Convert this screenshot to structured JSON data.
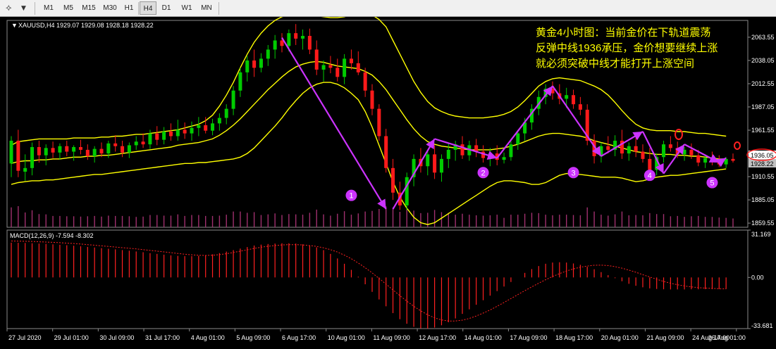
{
  "toolbar": {
    "drawing_tools_icon": "drawing-tools-icon",
    "timeframes": [
      {
        "label": "M1",
        "active": false
      },
      {
        "label": "M5",
        "active": false
      },
      {
        "label": "M15",
        "active": false
      },
      {
        "label": "M30",
        "active": false
      },
      {
        "label": "H1",
        "active": false
      },
      {
        "label": "H4",
        "active": true
      },
      {
        "label": "D1",
        "active": false
      },
      {
        "label": "W1",
        "active": false
      },
      {
        "label": "MN",
        "active": false
      }
    ]
  },
  "chart_data": [
    {
      "type": "candlestick",
      "header": "XAUUSD,H4  1929.07 1929.08 1928.18 1928.22",
      "ohlc_series": [
        [
          1925,
          1955,
          1910,
          1950
        ],
        [
          1950,
          1962,
          1910,
          1917
        ],
        [
          1916,
          1935,
          1906,
          1920
        ],
        [
          1920,
          1948,
          1912,
          1943
        ],
        [
          1943,
          1950,
          1926,
          1934
        ],
        [
          1934,
          1946,
          1923,
          1942
        ],
        [
          1942,
          1949,
          1931,
          1937
        ],
        [
          1937,
          1947,
          1929,
          1944
        ],
        [
          1944,
          1950,
          1933,
          1938
        ],
        [
          1938,
          1945,
          1928,
          1943
        ],
        [
          1943,
          1951,
          1935,
          1940
        ],
        [
          1940,
          1946,
          1929,
          1933
        ],
        [
          1933,
          1944,
          1926,
          1941
        ],
        [
          1941,
          1948,
          1932,
          1936
        ],
        [
          1936,
          1950,
          1931,
          1947
        ],
        [
          1947,
          1956,
          1938,
          1944
        ],
        [
          1944,
          1950,
          1932,
          1937
        ],
        [
          1937,
          1948,
          1931,
          1945
        ],
        [
          1945,
          1955,
          1940,
          1949
        ],
        [
          1949,
          1958,
          1942,
          1946
        ],
        [
          1946,
          1962,
          1941,
          1958
        ],
        [
          1958,
          1966,
          1945,
          1951
        ],
        [
          1951,
          1965,
          1946,
          1960
        ],
        [
          1960,
          1969,
          1950,
          1955
        ],
        [
          1955,
          1973,
          1950,
          1962
        ],
        [
          1962,
          1970,
          1952,
          1958
        ],
        [
          1958,
          1971,
          1950,
          1964
        ],
        [
          1964,
          1976,
          1955,
          1967
        ],
        [
          1967,
          1976,
          1958,
          1961
        ],
        [
          1961,
          1974,
          1956,
          1969
        ],
        [
          1969,
          1980,
          1961,
          1975
        ],
        [
          1975,
          1990,
          1968,
          1985
        ],
        [
          1985,
          2010,
          1978,
          2005
        ],
        [
          2005,
          2030,
          1998,
          2025
        ],
        [
          2025,
          2043,
          2015,
          2038
        ],
        [
          2038,
          2050,
          2020,
          2030
        ],
        [
          2030,
          2046,
          2025,
          2040
        ],
        [
          2040,
          2055,
          2032,
          2050
        ],
        [
          2050,
          2066,
          2040,
          2060
        ],
        [
          2060,
          2068,
          2047,
          2054
        ],
        [
          2054,
          2072,
          2048,
          2068
        ],
        [
          2068,
          2078,
          2055,
          2062
        ],
        [
          2062,
          2072,
          2050,
          2065
        ],
        [
          2065,
          2073,
          2045,
          2050
        ],
        [
          2050,
          2060,
          2022,
          2028
        ],
        [
          2028,
          2038,
          2015,
          2033
        ],
        [
          2033,
          2043,
          2024,
          2030
        ],
        [
          2030,
          2040,
          2015,
          2020
        ],
        [
          2020,
          2045,
          2012,
          2040
        ],
        [
          2040,
          2050,
          2028,
          2035
        ],
        [
          2035,
          2048,
          2022,
          2025
        ],
        [
          2025,
          2030,
          1998,
          2005
        ],
        [
          2005,
          2012,
          1978,
          1985
        ],
        [
          1985,
          1990,
          1950,
          1955
        ],
        [
          1955,
          1963,
          1915,
          1920
        ],
        [
          1920,
          1930,
          1885,
          1893
        ],
        [
          1893,
          1905,
          1874,
          1879
        ],
        [
          1879,
          1915,
          1874,
          1910
        ],
        [
          1910,
          1935,
          1900,
          1930
        ],
        [
          1930,
          1942,
          1915,
          1922
        ],
        [
          1922,
          1940,
          1912,
          1935
        ],
        [
          1935,
          1945,
          1908,
          1915
        ],
        [
          1915,
          1935,
          1905,
          1930
        ],
        [
          1930,
          1948,
          1920,
          1940
        ],
        [
          1940,
          1950,
          1928,
          1946
        ],
        [
          1946,
          1955,
          1930,
          1934
        ],
        [
          1934,
          1950,
          1928,
          1945
        ],
        [
          1945,
          1952,
          1932,
          1938
        ],
        [
          1938,
          1945,
          1926,
          1931
        ],
        [
          1931,
          1942,
          1922,
          1936
        ],
        [
          1936,
          1945,
          1923,
          1929
        ],
        [
          1929,
          1937,
          1925,
          1932
        ],
        [
          1932,
          1950,
          1928,
          1946
        ],
        [
          1946,
          1962,
          1940,
          1958
        ],
        [
          1958,
          1975,
          1950,
          1970
        ],
        [
          1970,
          1990,
          1962,
          1985
        ],
        [
          1985,
          2005,
          1978,
          1998
        ],
        [
          1998,
          2012,
          1990,
          2007
        ],
        [
          2007,
          2015,
          1995,
          2002
        ],
        [
          2002,
          2012,
          1990,
          1996
        ],
        [
          1996,
          2008,
          1986,
          2000
        ],
        [
          2000,
          2006,
          1985,
          1990
        ],
        [
          1990,
          1998,
          1978,
          1984
        ],
        [
          1984,
          1990,
          1945,
          1950
        ],
        [
          1950,
          1957,
          1925,
          1933
        ],
        [
          1933,
          1948,
          1926,
          1944
        ],
        [
          1944,
          1955,
          1936,
          1940
        ],
        [
          1940,
          1956,
          1933,
          1950
        ],
        [
          1950,
          1962,
          1930,
          1936
        ],
        [
          1936,
          1948,
          1928,
          1944
        ],
        [
          1944,
          1953,
          1932,
          1938
        ],
        [
          1938,
          1946,
          1926,
          1930
        ],
        [
          1930,
          1942,
          1915,
          1918
        ],
        [
          1918,
          1936,
          1912,
          1932
        ],
        [
          1932,
          1950,
          1926,
          1946
        ],
        [
          1946,
          1955,
          1938,
          1942
        ],
        [
          1942,
          1949,
          1931,
          1935
        ],
        [
          1935,
          1943,
          1928,
          1940
        ],
        [
          1940,
          1947,
          1930,
          1934
        ],
        [
          1934,
          1940,
          1922,
          1926
        ],
        [
          1926,
          1935,
          1920,
          1931
        ],
        [
          1931,
          1938,
          1923,
          1929
        ],
        [
          1929,
          1934,
          1921,
          1924
        ],
        [
          1924,
          1932,
          1920,
          1930
        ],
        [
          1930,
          1936,
          1926,
          1928
        ]
      ],
      "bollinger": {
        "upper": [
          1945,
          1949,
          1950,
          1951,
          1952,
          1952,
          1952,
          1952,
          1952,
          1953,
          1953,
          1953,
          1953,
          1954,
          1954,
          1955,
          1955,
          1956,
          1957,
          1957,
          1958,
          1959,
          1960,
          1961,
          1962,
          1964,
          1966,
          1968,
          1972,
          1978,
          1988,
          2000,
          2014,
          2030,
          2045,
          2058,
          2068,
          2076,
          2082,
          2086,
          2088,
          2089,
          2089,
          2088,
          2087,
          2086,
          2085,
          2085,
          2086,
          2088,
          2090,
          2090,
          2088,
          2083,
          2075,
          2060,
          2045,
          2030,
          2015,
          2003,
          1993,
          1986,
          1982,
          1979,
          1977,
          1976,
          1975,
          1975,
          1975,
          1976,
          1977,
          1979,
          1982,
          1987,
          1994,
          2002,
          2010,
          2015,
          2018,
          2019,
          2018,
          2017,
          2016,
          2013,
          2010,
          2006,
          2000,
          1992,
          1983,
          1975,
          1968,
          1964,
          1962,
          1961,
          1961,
          1961,
          1960,
          1960,
          1959,
          1958,
          1958,
          1957,
          1956,
          1955
        ],
        "middle": [
          1925,
          1927,
          1928,
          1928,
          1929,
          1929,
          1930,
          1930,
          1931,
          1932,
          1932,
          1933,
          1933,
          1934,
          1934,
          1935,
          1936,
          1937,
          1938,
          1939,
          1940,
          1941,
          1942,
          1943,
          1945,
          1946,
          1947,
          1948,
          1950,
          1952,
          1956,
          1961,
          1967,
          1974,
          1982,
          1990,
          1998,
          2006,
          2013,
          2020,
          2026,
          2031,
          2034,
          2036,
          2037,
          2036,
          2034,
          2032,
          2031,
          2030,
          2029,
          2026,
          2022,
          2015,
          2006,
          1995,
          1984,
          1973,
          1963,
          1955,
          1949,
          1946,
          1944,
          1943,
          1942,
          1941,
          1940,
          1940,
          1940,
          1940,
          1941,
          1942,
          1944,
          1946,
          1949,
          1952,
          1955,
          1957,
          1958,
          1958,
          1957,
          1956,
          1955,
          1953,
          1950,
          1948,
          1946,
          1944,
          1942,
          1940,
          1938,
          1937,
          1936,
          1935,
          1935,
          1935,
          1934,
          1934,
          1933,
          1933,
          1932,
          1931,
          1930,
          1930
        ],
        "lower": [
          1902,
          1904,
          1905,
          1906,
          1906,
          1907,
          1907,
          1908,
          1909,
          1910,
          1911,
          1912,
          1913,
          1913,
          1914,
          1915,
          1916,
          1917,
          1918,
          1919,
          1920,
          1921,
          1922,
          1923,
          1924,
          1925,
          1925,
          1926,
          1926,
          1927,
          1928,
          1929,
          1930,
          1932,
          1936,
          1942,
          1950,
          1958,
          1966,
          1975,
          1985,
          1994,
          2002,
          2008,
          2012,
          2014,
          2014,
          2012,
          2008,
          2002,
          1995,
          1982,
          1965,
          1945,
          1925,
          1905,
          1888,
          1876,
          1866,
          1860,
          1858,
          1860,
          1865,
          1870,
          1875,
          1880,
          1885,
          1890,
          1895,
          1900,
          1904,
          1906,
          1906,
          1905,
          1904,
          1902,
          1902,
          1904,
          1908,
          1912,
          1914,
          1913,
          1913,
          1912,
          1911,
          1910,
          1910,
          1910,
          1909,
          1907,
          1905,
          1906,
          1908,
          1910,
          1911,
          1912,
          1912,
          1913,
          1914,
          1915,
          1916,
          1917,
          1918,
          1919
        ]
      },
      "y_ticks": [
        "2063.55",
        "2038.05",
        "2012.55",
        "1987.05",
        "1961.55",
        "1936.05",
        "1910.55",
        "1885.05",
        "1859.55"
      ],
      "y_range": [
        1855,
        2082
      ],
      "current_price_labels": [
        "1936.05",
        "1928.22"
      ],
      "annotation_lines": [
        "黄金4小时图：当前金价在下轨道震荡",
        "反弹中线1936承压，金价想要继续上涨",
        "就必须突破中线才能打开上涨空间"
      ],
      "markers": [
        "1",
        "2",
        "3",
        "4",
        "5"
      ],
      "colors": {
        "bull": "#00cc00",
        "bear": "#ff1a1a",
        "bands": "#ffff00",
        "arrows": "#cc33ff",
        "volume": "#a0306e",
        "annotation": "#ffff00",
        "highlight": "#ff2020"
      }
    },
    {
      "type": "bar",
      "header": "MACD(12,26,9) -7.594 -8.302",
      "y_ticks": [
        "31.169",
        "0.00",
        "-33.681"
      ],
      "y_range": [
        -33.681,
        31.169
      ],
      "histogram": [
        22.9,
        22.8,
        22.7,
        22.5,
        22.3,
        22.1,
        21.8,
        21.5,
        21.2,
        20.9,
        20.5,
        20.1,
        19.7,
        19.3,
        18.9,
        18.5,
        18.0,
        17.6,
        17.1,
        16.6,
        16.0,
        15.5,
        15.0,
        14.5,
        14.2,
        14.0,
        14.0,
        14.2,
        14.6,
        15.2,
        16.0,
        17.0,
        18.0,
        19.0,
        20.0,
        21.0,
        21.6,
        22.0,
        22.3,
        22.5,
        22.5,
        22.3,
        21.8,
        21.0,
        19.8,
        18.0,
        15.5,
        12.5,
        9.0,
        5.0,
        0.5,
        -4.5,
        -9.5,
        -14.5,
        -19.0,
        -23.5,
        -27.5,
        -30.5,
        -32.5,
        -33.5,
        -33.7,
        -33.0,
        -31.5,
        -29.5,
        -27.0,
        -24.0,
        -21.0,
        -18.0,
        -15.0,
        -12.0,
        -9.0,
        -6.0,
        -3.0,
        0.0,
        3.0,
        5.5,
        7.5,
        9.0,
        9.8,
        10.0,
        9.8,
        9.2,
        8.3,
        7.0,
        5.4,
        3.5,
        1.5,
        -0.5,
        -2.5,
        -4.2,
        -5.5,
        -6.5,
        -7.2,
        -7.6,
        -7.8,
        -7.9,
        -7.9,
        -7.9,
        -7.8,
        -7.8,
        -7.7,
        -7.7,
        -7.6,
        -7.6
      ],
      "signal": [
        24.0,
        23.9,
        23.8,
        23.7,
        23.5,
        23.3,
        23.1,
        22.9,
        22.6,
        22.3,
        22.0,
        21.6,
        21.2,
        20.8,
        20.4,
        20.0,
        19.6,
        19.2,
        18.8,
        18.3,
        17.8,
        17.3,
        16.8,
        16.3,
        15.8,
        15.3,
        14.9,
        14.6,
        14.5,
        14.6,
        15.0,
        15.6,
        16.4,
        17.3,
        18.2,
        19.1,
        19.9,
        20.5,
        21.0,
        21.4,
        21.6,
        21.6,
        21.4,
        21.0,
        20.4,
        19.5,
        18.3,
        16.7,
        14.7,
        12.3,
        9.5,
        6.4,
        3.0,
        -0.6,
        -4.4,
        -8.2,
        -12.0,
        -15.6,
        -19.0,
        -22.0,
        -24.6,
        -26.6,
        -28.0,
        -28.7,
        -28.7,
        -28.1,
        -27.0,
        -25.4,
        -23.5,
        -21.4,
        -19.0,
        -16.5,
        -13.9,
        -11.3,
        -8.7,
        -6.2,
        -3.8,
        -1.5,
        0.6,
        2.5,
        4.2,
        5.6,
        6.7,
        7.5,
        8.0,
        8.1,
        7.8,
        7.1,
        6.1,
        4.8,
        3.4,
        1.8,
        0.3,
        -1.2,
        -2.6,
        -3.8,
        -4.8,
        -5.6,
        -6.2,
        -6.7,
        -7.0,
        -7.2,
        -7.4,
        -7.5
      ]
    }
  ],
  "x_axis_labels": [
    "27 Jul 2020",
    "29 Jul 01:00",
    "30 Jul 09:00",
    "31 Jul 17:00",
    "4 Aug 01:00",
    "5 Aug 09:00",
    "6 Aug 17:00",
    "10 Aug 01:00",
    "11 Aug 09:00",
    "12 Aug 17:00",
    "14 Aug 01:00",
    "17 Aug 09:00",
    "18 Aug 17:00",
    "20 Aug 01:00",
    "21 Aug 09:00",
    "24 Aug 17:00",
    "26 Aug 01:00"
  ]
}
